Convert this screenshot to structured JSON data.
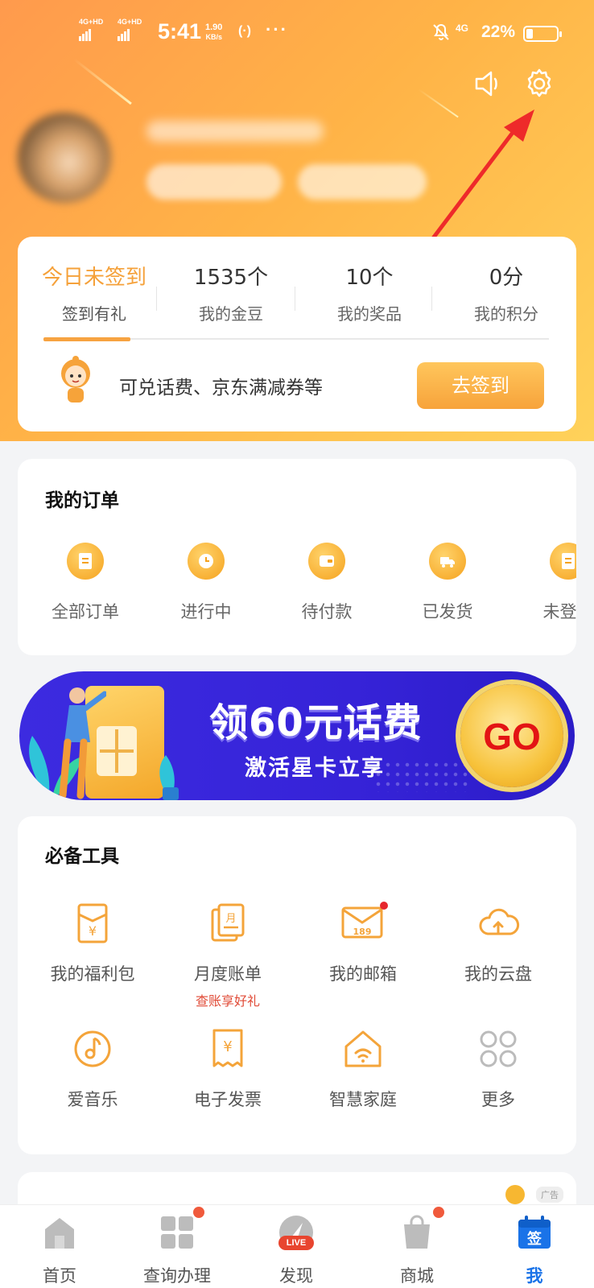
{
  "status_bar": {
    "sim1": "4G+HD",
    "sim2": "4G+HD",
    "time": "5:41",
    "speed_value": "1.90",
    "speed_unit": "KB/s",
    "network": "4G",
    "battery_percent": "22%",
    "battery_level": 0.22
  },
  "header": {
    "speaker_icon": "speaker-icon",
    "settings_icon": "settings-gear-icon"
  },
  "points": {
    "columns": [
      {
        "value": "今日未签到",
        "label": "签到有礼"
      },
      {
        "value": "1535个",
        "label": "我的金豆"
      },
      {
        "value": "10个",
        "label": "我的奖品"
      },
      {
        "value": "0分",
        "label": "我的积分"
      }
    ],
    "promo_text": "可兑话费、京东满减券等",
    "signin_button": "去签到"
  },
  "orders": {
    "title": "我的订单",
    "items": [
      {
        "label": "全部订单",
        "icon": "list-icon"
      },
      {
        "label": "进行中",
        "icon": "clock-icon"
      },
      {
        "label": "待付款",
        "icon": "wallet-icon"
      },
      {
        "label": "已发货",
        "icon": "truck-icon"
      },
      {
        "label": "未登录",
        "icon": "list-icon"
      }
    ]
  },
  "banner": {
    "main_text": "领60元话费",
    "sub_text": "激活星卡立享",
    "go_text": "GO"
  },
  "tools": {
    "title": "必备工具",
    "items": [
      {
        "label": "我的福利包",
        "icon": "welfare-pack-icon"
      },
      {
        "label": "月度账单",
        "sublabel": "查账享好礼",
        "icon": "monthly-bill-icon"
      },
      {
        "label": "我的邮箱",
        "icon": "mail-189-icon"
      },
      {
        "label": "我的云盘",
        "icon": "cloud-icon"
      },
      {
        "label": "爱音乐",
        "icon": "music-icon"
      },
      {
        "label": "电子发票",
        "icon": "invoice-icon"
      },
      {
        "label": "智慧家庭",
        "icon": "smart-home-icon"
      },
      {
        "label": "更多",
        "icon": "more-grid-icon"
      }
    ]
  },
  "ad": {
    "badge": "广告"
  },
  "bottom_nav": {
    "items": [
      {
        "label": "首页",
        "icon": "home-icon"
      },
      {
        "label": "查询办理",
        "icon": "grid-icon"
      },
      {
        "label": "发现",
        "icon": "live-icon",
        "badge_text": "LIVE"
      },
      {
        "label": "商城",
        "icon": "shopping-bag-icon"
      },
      {
        "label": "我",
        "icon": "calendar-sign-icon",
        "badge_text": "签"
      }
    ]
  },
  "colors": {
    "accent_orange": "#f7a341",
    "active_tab": "#1a73e8",
    "banner_blue": "#3623d8",
    "notification_red": "#e6272d"
  }
}
